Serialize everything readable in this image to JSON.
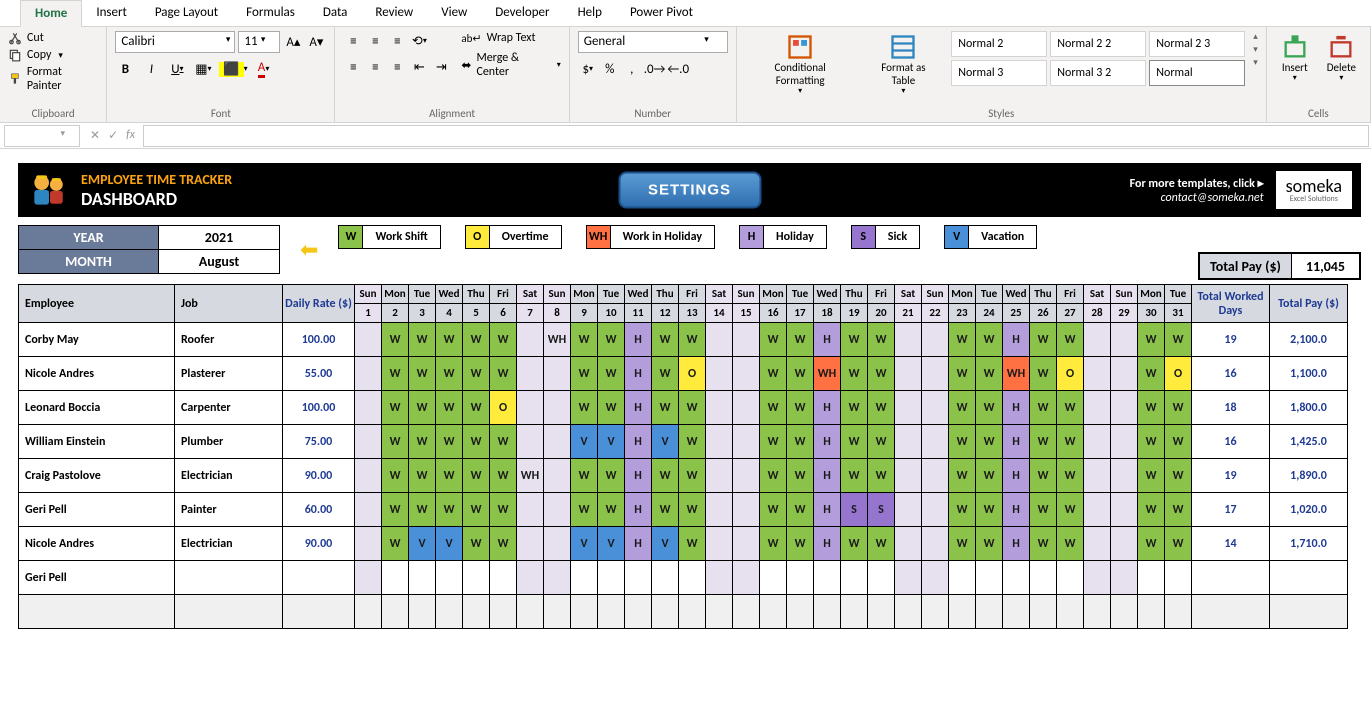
{
  "ribbon": {
    "tabs": [
      "Home",
      "Insert",
      "Page Layout",
      "Formulas",
      "Data",
      "Review",
      "View",
      "Developer",
      "Help",
      "Power Pivot"
    ],
    "active": "Home",
    "clipboard": {
      "cut": "Cut",
      "copy": "Copy",
      "paint": "Format Painter",
      "label": "Clipboard"
    },
    "font": {
      "name": "Calibri",
      "size": "11",
      "label": "Font"
    },
    "alignment": {
      "wrap": "Wrap Text",
      "merge": "Merge & Center",
      "label": "Alignment"
    },
    "number": {
      "format": "General",
      "label": "Number"
    },
    "styles": {
      "cond": "Conditional Formatting",
      "table": "Format as Table",
      "cells": [
        "Normal 2",
        "Normal 2 2",
        "Normal 2 3",
        "Normal 3",
        "Normal 3 2",
        "Normal"
      ],
      "label": "Styles"
    },
    "cells": {
      "insert": "Insert",
      "delete": "Delete",
      "label": "Cells"
    }
  },
  "formulabar": {
    "name": "",
    "fx": ""
  },
  "dashboard": {
    "title": "EMPLOYEE TIME TRACKER",
    "subtitle": "DASHBOARD",
    "settings": "SETTINGS",
    "moreTemplates": "For more templates, click ▸",
    "contact": "contact@someka.net",
    "brand": "someka",
    "brandSub": "Excel Solutions",
    "yearLabel": "YEAR",
    "year": "2021",
    "monthLabel": "MONTH",
    "month": "August",
    "legend": [
      {
        "code": "W",
        "label": "Work Shift",
        "cls": "c-W"
      },
      {
        "code": "O",
        "label": "Overtime",
        "cls": "c-O"
      },
      {
        "code": "WH",
        "label": "Work in Holiday",
        "cls": "c-WH"
      },
      {
        "code": "H",
        "label": "Holiday",
        "cls": "c-H"
      },
      {
        "code": "S",
        "label": "Sick",
        "cls": "c-S"
      },
      {
        "code": "V",
        "label": "Vacation",
        "cls": "c-V"
      }
    ],
    "totalPayLabel": "Total Pay ($)",
    "totalPay": "11,045",
    "headers": {
      "employee": "Employee",
      "job": "Job",
      "rate": "Daily Rate ($)",
      "totalDays": "Total Worked Days",
      "totalPay": "Total Pay ($)"
    },
    "days": {
      "dow": [
        "Sun",
        "Mon",
        "Tue",
        "Wed",
        "Thu",
        "Fri",
        "Sat",
        "Sun",
        "Mon",
        "Tue",
        "Wed",
        "Thu",
        "Fri",
        "Sat",
        "Sun",
        "Mon",
        "Tue",
        "Wed",
        "Thu",
        "Fri",
        "Sat",
        "Sun",
        "Mon",
        "Tue",
        "Wed",
        "Thu",
        "Fri",
        "Sat",
        "Sun",
        "Mon",
        "Tue"
      ],
      "num": [
        "1",
        "2",
        "3",
        "4",
        "5",
        "6",
        "7",
        "8",
        "9",
        "10",
        "11",
        "12",
        "13",
        "14",
        "15",
        "16",
        "17",
        "18",
        "19",
        "20",
        "21",
        "22",
        "23",
        "24",
        "25",
        "26",
        "27",
        "28",
        "29",
        "30",
        "31"
      ],
      "weekend": [
        true,
        false,
        false,
        false,
        false,
        false,
        true,
        true,
        false,
        false,
        false,
        false,
        false,
        true,
        true,
        false,
        false,
        false,
        false,
        false,
        true,
        true,
        false,
        false,
        false,
        false,
        false,
        true,
        true,
        false,
        false
      ]
    },
    "rows": [
      {
        "name": "Corby May",
        "job": "Roofer",
        "rate": "100.00",
        "days": [
          "",
          "W",
          "W",
          "W",
          "W",
          "W",
          "",
          "WH",
          "W",
          "W",
          "H",
          "W",
          "W",
          "",
          "",
          "W",
          "W",
          "H",
          "W",
          "W",
          "",
          "",
          "W",
          "W",
          "H",
          "W",
          "W",
          "",
          "",
          "W",
          "W"
        ],
        "totalDays": "19",
        "totalPay": "2,100.0"
      },
      {
        "name": "Nicole Andres",
        "job": "Plasterer",
        "rate": "55.00",
        "days": [
          "",
          "W",
          "W",
          "W",
          "W",
          "W",
          "",
          "",
          "W",
          "W",
          "H",
          "W",
          "O",
          "",
          "",
          "W",
          "W",
          "WH",
          "W",
          "W",
          "",
          "",
          "W",
          "W",
          "WH",
          "W",
          "O",
          "",
          "",
          "W",
          "O"
        ],
        "totalDays": "16",
        "totalPay": "1,100.0"
      },
      {
        "name": "Leonard Boccia",
        "job": "Carpenter",
        "rate": "100.00",
        "days": [
          "",
          "W",
          "W",
          "W",
          "W",
          "O",
          "",
          "",
          "W",
          "W",
          "H",
          "W",
          "W",
          "",
          "",
          "W",
          "W",
          "H",
          "W",
          "W",
          "",
          "",
          "W",
          "W",
          "H",
          "W",
          "W",
          "",
          "",
          "W",
          "W"
        ],
        "totalDays": "18",
        "totalPay": "1,800.0"
      },
      {
        "name": "William Einstein",
        "job": "Plumber",
        "rate": "75.00",
        "days": [
          "",
          "W",
          "W",
          "W",
          "W",
          "W",
          "",
          "",
          "V",
          "V",
          "H",
          "V",
          "W",
          "",
          "",
          "W",
          "W",
          "H",
          "W",
          "W",
          "",
          "",
          "W",
          "W",
          "H",
          "W",
          "W",
          "",
          "",
          "W",
          "W"
        ],
        "totalDays": "16",
        "totalPay": "1,425.0"
      },
      {
        "name": "Craig Pastolove",
        "job": "Electrician",
        "rate": "90.00",
        "days": [
          "",
          "W",
          "W",
          "W",
          "W",
          "W",
          "WH",
          "",
          "W",
          "W",
          "H",
          "W",
          "W",
          "",
          "",
          "W",
          "W",
          "H",
          "W",
          "W",
          "",
          "",
          "W",
          "W",
          "H",
          "W",
          "W",
          "",
          "",
          "W",
          "W"
        ],
        "totalDays": "19",
        "totalPay": "1,890.0"
      },
      {
        "name": "Geri Pell",
        "job": "Painter",
        "rate": "60.00",
        "days": [
          "",
          "W",
          "W",
          "W",
          "W",
          "W",
          "",
          "",
          "W",
          "W",
          "H",
          "W",
          "W",
          "",
          "",
          "W",
          "W",
          "H",
          "S",
          "S",
          "",
          "",
          "W",
          "W",
          "H",
          "W",
          "W",
          "",
          "",
          "W",
          "W"
        ],
        "totalDays": "17",
        "totalPay": "1,020.0"
      },
      {
        "name": "Nicole Andres",
        "job": "Electrician",
        "rate": "90.00",
        "days": [
          "",
          "W",
          "V",
          "V",
          "W",
          "W",
          "",
          "",
          "V",
          "V",
          "H",
          "V",
          "W",
          "",
          "",
          "W",
          "W",
          "H",
          "W",
          "W",
          "",
          "",
          "W",
          "W",
          "H",
          "W",
          "W",
          "",
          "",
          "W",
          "W"
        ],
        "totalDays": "14",
        "totalPay": "1,710.0"
      },
      {
        "name": "Geri Pell",
        "job": "",
        "rate": "",
        "days": [
          "",
          "",
          "",
          "",
          "",
          "",
          "",
          "",
          "",
          "",
          "",
          "",
          "",
          "",
          "",
          "",
          "",
          "",
          "",
          "",
          "",
          "",
          "",
          "",
          "",
          "",
          "",
          "",
          "",
          "",
          ""
        ],
        "totalDays": "",
        "totalPay": ""
      }
    ]
  }
}
